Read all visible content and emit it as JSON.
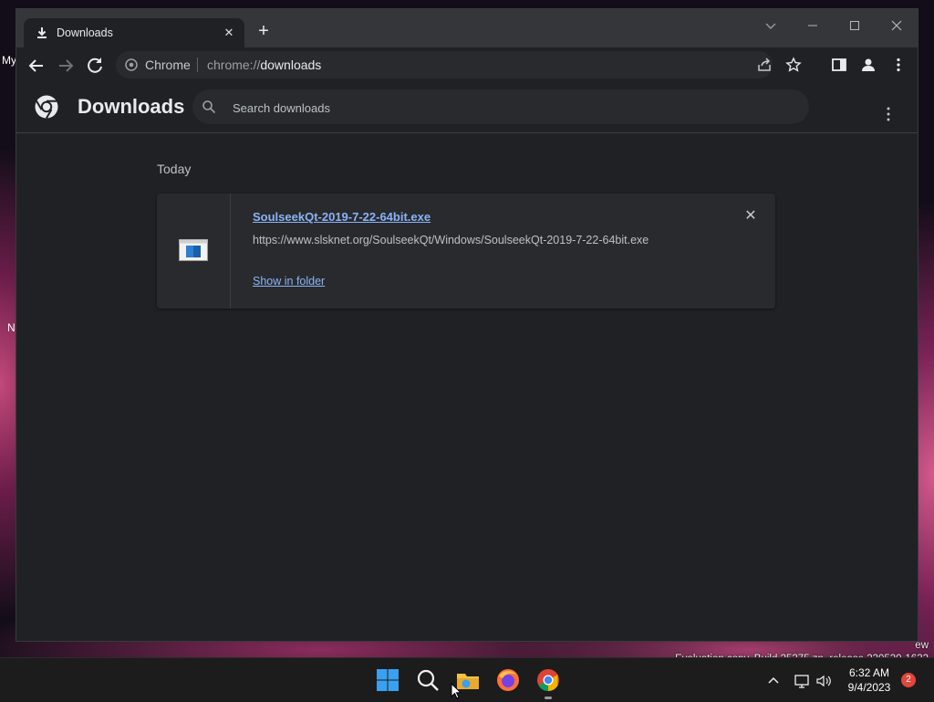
{
  "desktop": {
    "label_my": "My",
    "label_n": "N",
    "watermark_line1": "ew",
    "watermark_line2": "Evaluation copy. Build 25375.zn_release.230520-1632"
  },
  "browser": {
    "tab_title": "Downloads",
    "omnibox": {
      "site_label": "Chrome",
      "url_scheme": "chrome://",
      "url_path": "downloads"
    }
  },
  "downloads_page": {
    "title": "Downloads",
    "search_placeholder": "Search downloads",
    "section_label": "Today",
    "items": [
      {
        "filename": "SoulseekQt-2019-7-22-64bit.exe",
        "url": "https://www.slsknet.org/SoulseekQt/Windows/SoulseekQt-2019-7-22-64bit.exe",
        "action_label": "Show in folder"
      }
    ]
  },
  "taskbar": {
    "time": "6:32 AM",
    "date": "9/4/2023",
    "notification_count": "2",
    "apps": [
      "start-icon",
      "search-icon",
      "file-explorer-icon",
      "firefox-icon",
      "chrome-icon"
    ]
  },
  "colors": {
    "accent_link": "#8ab4f8",
    "page_bg": "#202124",
    "card_bg": "#292a2d",
    "tabstrip_bg": "#35363a"
  }
}
